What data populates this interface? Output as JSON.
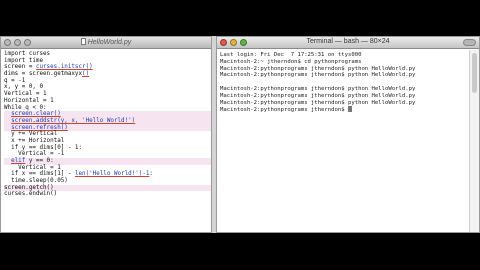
{
  "editor": {
    "title": "HelloWorld.py",
    "code": [
      {
        "t": "import curses",
        "hl": false
      },
      {
        "t": "import time",
        "hl": false
      },
      {
        "pre": "screen = ",
        "u": "curses.initscr()",
        "post": "",
        "hl": false
      },
      {
        "pre": "dims = screen.getmaxyx",
        "u": "()",
        "post": "",
        "hl": false
      },
      {
        "t": "q = -1",
        "hl": false
      },
      {
        "t": "x, y = 0, 0",
        "hl": false
      },
      {
        "t": "Vertical = 1",
        "hl": false
      },
      {
        "t": "Horizontal = 1",
        "hl": false
      },
      {
        "t": "While q < 0:",
        "hl": false
      },
      {
        "pre": "  ",
        "u": "screen.clear()",
        "post": "",
        "hl": true
      },
      {
        "pre": "  ",
        "u": "screen.addstr(y, x, 'Hello World!')",
        "post": "",
        "hl": true
      },
      {
        "pre": "  ",
        "u": "screen.refresh()",
        "post": "",
        "hl": true
      },
      {
        "t": "  y += Vertical",
        "hl": false
      },
      {
        "t": "  x += Horizontal",
        "hl": false
      },
      {
        "t": "  if y == dims[0] - 1:",
        "hl": false
      },
      {
        "t": "    Vertical = -1",
        "hl": false
      },
      {
        "pre": "  ",
        "u": "elif",
        "post": " y == 0:",
        "hl": true
      },
      {
        "t": "    Vertical = 1",
        "hl": false
      },
      {
        "pre": "  if x == dims[1] - ",
        "u": "len('Hello World!')-1",
        "post": ":",
        "hl": false
      },
      {
        "t": "  time.sleep(0.05)",
        "hl": false
      },
      {
        "t": "screen.getch()",
        "hl": true
      },
      {
        "t": "curses.endwin()",
        "hl": false
      }
    ]
  },
  "terminal": {
    "title": "Terminal — bash — 80×24",
    "lines": [
      "Last login: Fri Dec  7 17:25:31 on ttys000",
      "Macintosh-2:~ jtherndon$ cd pythonprograms",
      "Macintosh-2:pythonprograms jtherndon$ python HelloWorld.py",
      "Macintosh-2:pythonprograms jtherndon$ python HelloWorld.py",
      "",
      "Macintosh-2:pythonprograms jtherndon$ python HelloWorld.py",
      "Macintosh-2:pythonprograms jtherndon$ python HelloWorld.py",
      "Macintosh-2:pythonprograms jtherndon$ python HelloWorld.py",
      "Macintosh-2:pythonprograms jtherndon$ "
    ]
  }
}
